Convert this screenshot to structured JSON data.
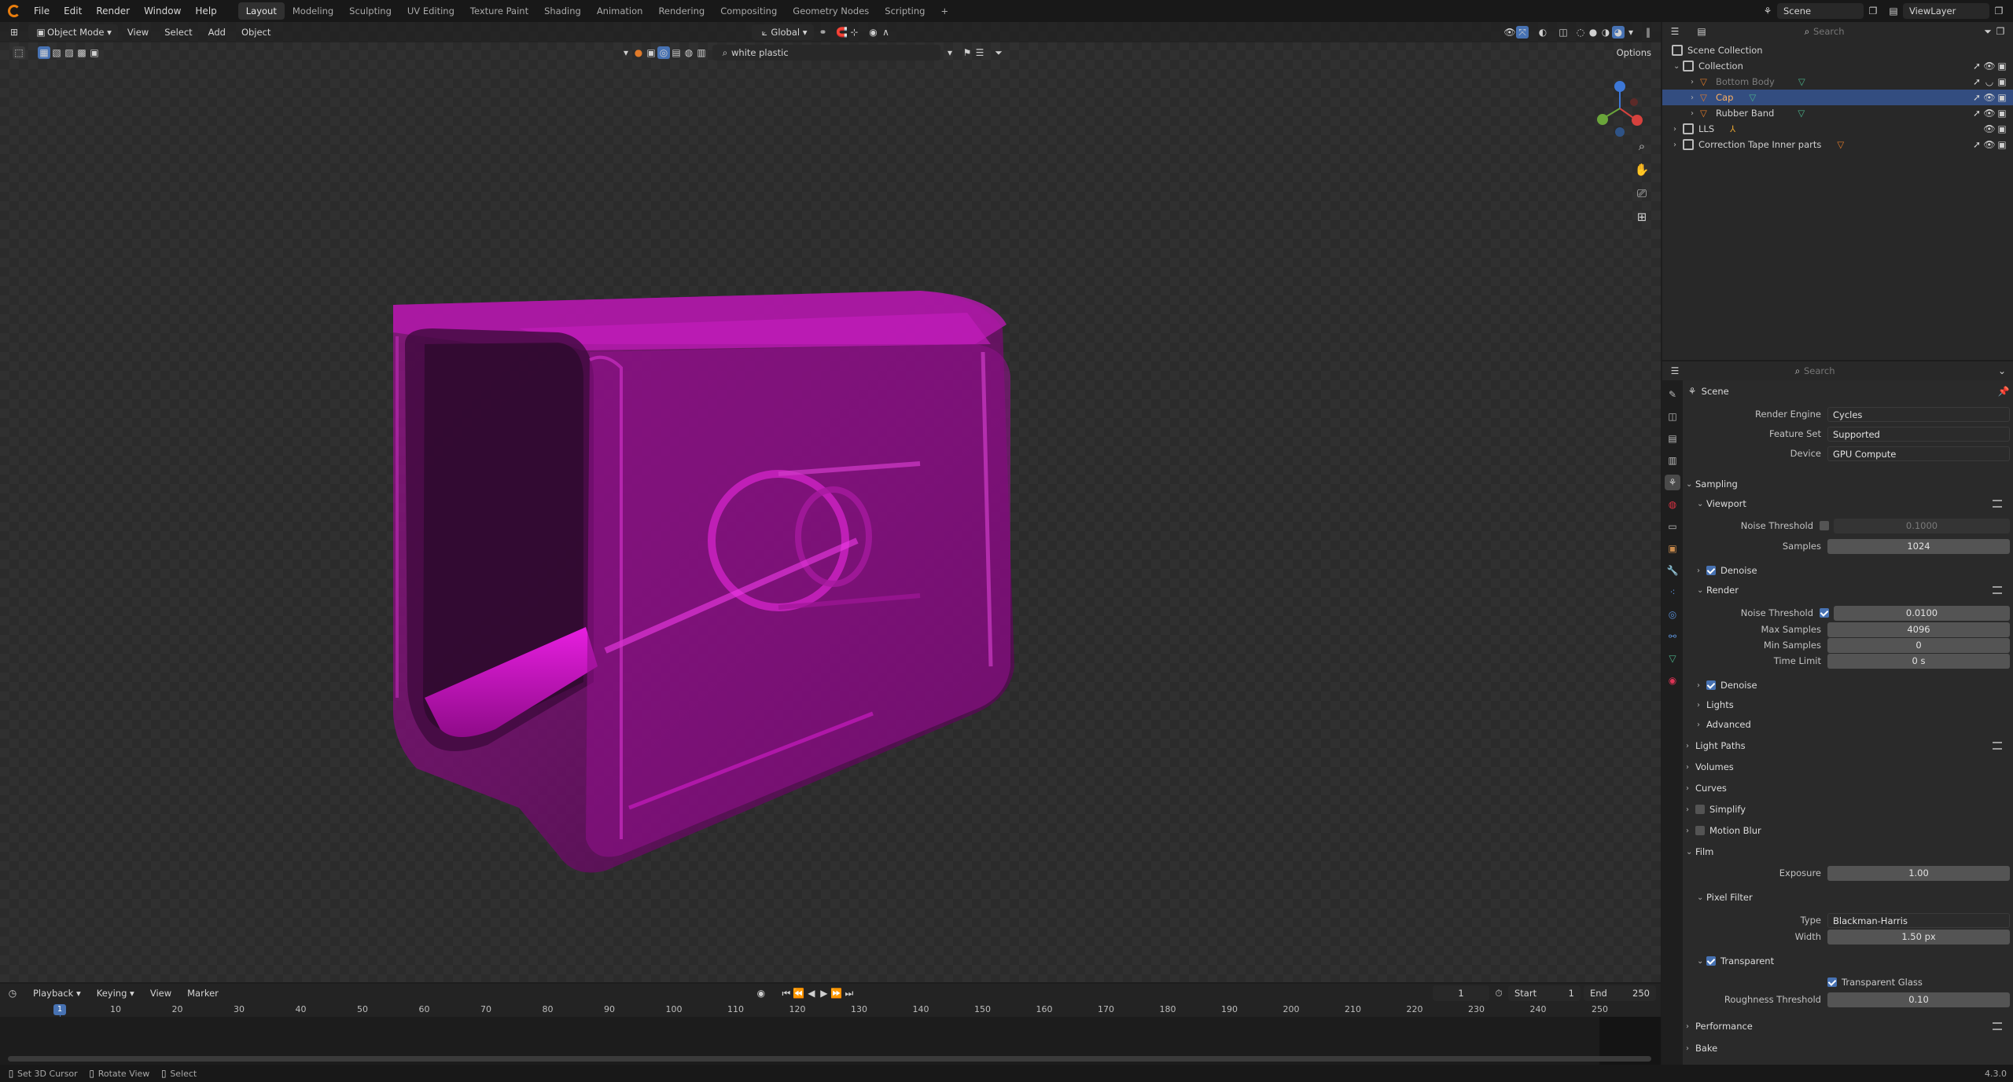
{
  "app": {
    "version": "4.3.0"
  },
  "menus": [
    "File",
    "Edit",
    "Render",
    "Window",
    "Help"
  ],
  "workspaces": [
    "Layout",
    "Modeling",
    "Sculpting",
    "UV Editing",
    "Texture Paint",
    "Shading",
    "Animation",
    "Rendering",
    "Compositing",
    "Geometry Nodes",
    "Scripting"
  ],
  "active_workspace": "Layout",
  "top_right": {
    "scene": "Scene",
    "view_layer": "ViewLayer"
  },
  "viewport": {
    "mode": "Object Mode",
    "menus": [
      "View",
      "Select",
      "Add",
      "Object"
    ],
    "transform": "Global",
    "search_value": "white plastic",
    "options": "Options",
    "object_color": "#c40fc2"
  },
  "outliner": {
    "search_placeholder": "Search",
    "rows": [
      {
        "label": "Scene Collection",
        "level": 0,
        "kind": "collection"
      },
      {
        "label": "Collection",
        "level": 1,
        "kind": "collection"
      },
      {
        "label": "Bottom Body",
        "level": 2,
        "kind": "mesh",
        "dim": true
      },
      {
        "label": "Cap",
        "level": 2,
        "kind": "mesh",
        "selected": true
      },
      {
        "label": "Rubber Band",
        "level": 2,
        "kind": "mesh"
      },
      {
        "label": "LLS",
        "level": 1,
        "kind": "collection"
      },
      {
        "label": "Correction Tape Inner parts",
        "level": 1,
        "kind": "collection"
      }
    ]
  },
  "properties": {
    "search_placeholder": "Search",
    "context": "Scene",
    "render_engine": {
      "label": "Render Engine",
      "value": "Cycles"
    },
    "feature_set": {
      "label": "Feature Set",
      "value": "Supported"
    },
    "device": {
      "label": "Device",
      "value": "GPU Compute"
    },
    "sampling": "Sampling",
    "viewport": "Viewport",
    "vp_noise_threshold": {
      "label": "Noise Threshold",
      "value": "0.1000"
    },
    "vp_samples": {
      "label": "Samples",
      "value": "1024"
    },
    "denoise": "Denoise",
    "render": "Render",
    "r_noise_threshold": {
      "label": "Noise Threshold",
      "value": "0.0100"
    },
    "max_samples": {
      "label": "Max Samples",
      "value": "4096"
    },
    "min_samples": {
      "label": "Min Samples",
      "value": "0"
    },
    "time_limit": {
      "label": "Time Limit",
      "value": "0 s"
    },
    "denoise2": "Denoise",
    "lights": "Lights",
    "advanced": "Advanced",
    "light_paths": "Light Paths",
    "volumes": "Volumes",
    "curves": "Curves",
    "simplify": "Simplify",
    "motion_blur": "Motion Blur",
    "film": "Film",
    "exposure": {
      "label": "Exposure",
      "value": "1.00"
    },
    "pixel_filter": "Pixel Filter",
    "filter_type": {
      "label": "Type",
      "value": "Blackman-Harris"
    },
    "filter_width": {
      "label": "Width",
      "value": "1.50 px"
    },
    "transparent": "Transparent",
    "transparent_glass": "Transparent Glass",
    "roughness_threshold": {
      "label": "Roughness Threshold",
      "value": "0.10"
    },
    "performance": "Performance",
    "bake": "Bake"
  },
  "timeline": {
    "menus": [
      "Playback",
      "Keying",
      "View",
      "Marker"
    ],
    "current_frame": "1",
    "start_label": "Start",
    "start": "1",
    "end_label": "End",
    "end": "250",
    "ticks": [
      "10",
      "20",
      "30",
      "40",
      "50",
      "60",
      "70",
      "80",
      "90",
      "100",
      "110",
      "120",
      "130",
      "140",
      "150",
      "160",
      "170",
      "180",
      "190",
      "200",
      "210",
      "220",
      "230",
      "240",
      "250"
    ],
    "playhead_label": "1"
  },
  "status": {
    "items": [
      "Set 3D Cursor",
      "Rotate View",
      "Select"
    ]
  }
}
